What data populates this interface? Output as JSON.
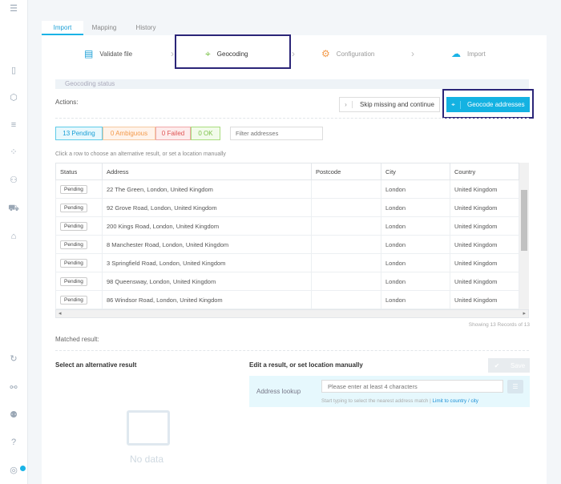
{
  "tabs": [
    "Import",
    "Mapping",
    "History"
  ],
  "steps": [
    {
      "label": "Validate file"
    },
    {
      "label": "Geocoding"
    },
    {
      "label": "Configuration"
    },
    {
      "label": "Import"
    }
  ],
  "status_title": "Geocoding status",
  "actions_label": "Actions:",
  "skip_button": "Skip missing and continue",
  "geocode_button": "Geocode addresses",
  "filters": {
    "pending": "13 Pending",
    "ambiguous": "0 Ambiguous",
    "failed": "0 Failed",
    "ok": "0 OK"
  },
  "filter_placeholder": "Filter addresses",
  "hint": "Click a row to choose an alternative result, or set a location manually",
  "table": {
    "headers": [
      "Status",
      "Address",
      "Postcode",
      "City",
      "Country"
    ],
    "rows": [
      [
        "Pending",
        "22 The Green, London, United Kingdom",
        "",
        "London",
        "United Kingdom"
      ],
      [
        "Pending",
        "92 Grove Road, London, United Kingdom",
        "",
        "London",
        "United Kingdom"
      ],
      [
        "Pending",
        "200 Kings Road, London, United Kingdom",
        "",
        "London",
        "United Kingdom"
      ],
      [
        "Pending",
        "8 Manchester Road, London, United Kingdom",
        "",
        "London",
        "United Kingdom"
      ],
      [
        "Pending",
        "3 Springfield Road, London, United Kingdom",
        "",
        "London",
        "United Kingdom"
      ],
      [
        "Pending",
        "98 Queensway, London, United Kingdom",
        "",
        "London",
        "United Kingdom"
      ],
      [
        "Pending",
        "86 Windsor Road, London, United Kingdom",
        "",
        "London",
        "United Kingdom"
      ]
    ]
  },
  "records": "Showing 13 Records of 13",
  "matched_label": "Matched result:",
  "alt_title": "Select an alternative result",
  "no_data": "No data",
  "edit_title": "Edit a result, or set location manually",
  "save": "Save",
  "lookup_label": "Address lookup",
  "lookup_placeholder": "Please enter at least 4 characters",
  "lookup_help": "Start typing to select the nearest address match |",
  "lookup_link": "Limit to country / city",
  "colors": {
    "accent": "#1ab3e6",
    "highlight": "#2b2578"
  }
}
